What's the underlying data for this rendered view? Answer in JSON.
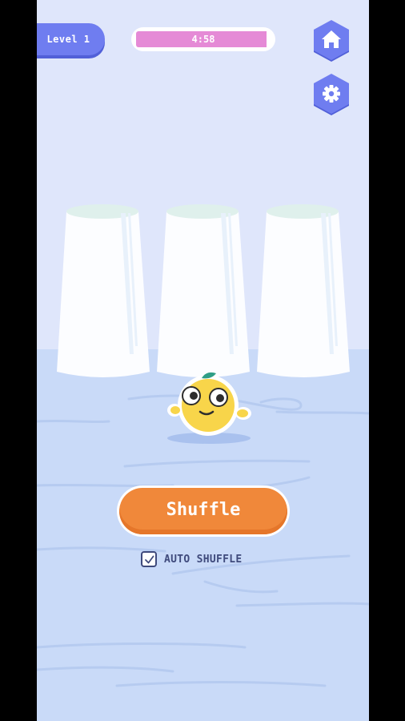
{
  "hud": {
    "level_label": "Level 1",
    "timer_text": "4:58",
    "timer_progress": 0.97
  },
  "buttons": {
    "home_icon": "home-icon",
    "settings_icon": "gear-icon",
    "shuffle_label": "Shuffle"
  },
  "options": {
    "auto_shuffle_label": "AUTO SHUFFLE",
    "auto_shuffle_checked": true
  },
  "cups": [
    {
      "id": "cup-left"
    },
    {
      "id": "cup-middle"
    },
    {
      "id": "cup-right"
    }
  ],
  "colors": {
    "accent_blue": "#6f7df0",
    "accent_orange": "#f0883a",
    "timer_pink": "#e58ad6",
    "wall": "#dfe6fb",
    "floor": "#c9daf8"
  }
}
